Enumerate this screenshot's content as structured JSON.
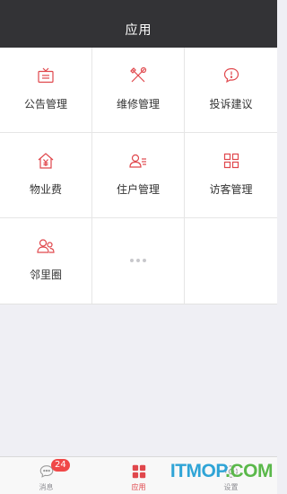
{
  "header": {
    "title": "应用"
  },
  "grid": {
    "items": [
      {
        "label": "公告管理",
        "icon": "announcement-icon"
      },
      {
        "label": "维修管理",
        "icon": "repair-tools-icon"
      },
      {
        "label": "投诉建议",
        "icon": "complaint-bubble-icon"
      },
      {
        "label": "物业费",
        "icon": "property-fee-icon"
      },
      {
        "label": "住户管理",
        "icon": "resident-list-icon"
      },
      {
        "label": "访客管理",
        "icon": "visitor-grid-icon"
      },
      {
        "label": "邻里圈",
        "icon": "neighbors-icon"
      },
      {
        "label": "",
        "icon": "more-dots-icon"
      }
    ]
  },
  "tabbar": {
    "tabs": [
      {
        "label": "消息",
        "icon": "chat-icon",
        "badge": "24"
      },
      {
        "label": "应用",
        "icon": "apps-icon",
        "active": true
      },
      {
        "label": "设置",
        "icon": "settings-icon"
      }
    ]
  },
  "watermark": {
    "text_a": "ITMOP",
    "text_b": ".COM"
  },
  "colors": {
    "accent": "#e0474c",
    "nav_bg": "#333336",
    "badge": "#f04848"
  }
}
